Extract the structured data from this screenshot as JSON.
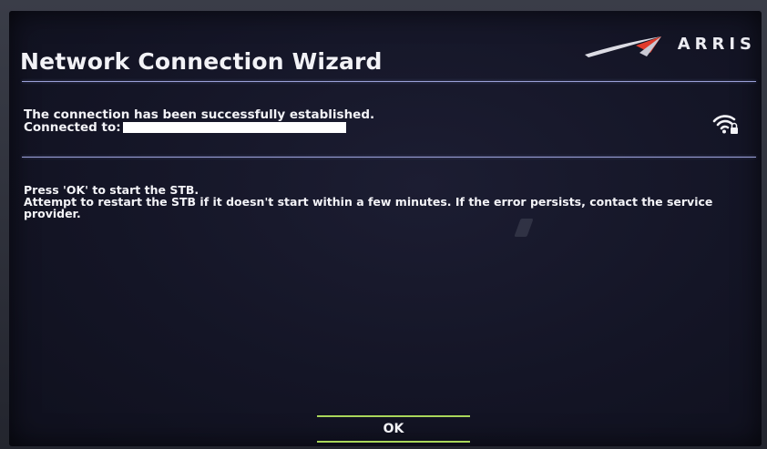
{
  "wizard": {
    "title": "Network Connection Wizard"
  },
  "brand": {
    "logo_text": "ARRIS",
    "logo_color": "#ececf2",
    "swoosh_accent": "#e13b2b"
  },
  "status": {
    "message": "The connection has been successfully established.",
    "connected_label": "Connected to:",
    "wifi_icon": "wifi-locked-icon"
  },
  "instructions": {
    "line1": "Press 'OK' to start the STB.",
    "line2": "Attempt to restart the STB if it doesn't start within a few minutes. If the error persists, contact the service provider."
  },
  "actions": {
    "ok_label": "OK",
    "focus_color": "#a9d65a"
  },
  "theme": {
    "background": "#141526",
    "divider": "#9aa0d8",
    "text": "#f3f3f7"
  }
}
